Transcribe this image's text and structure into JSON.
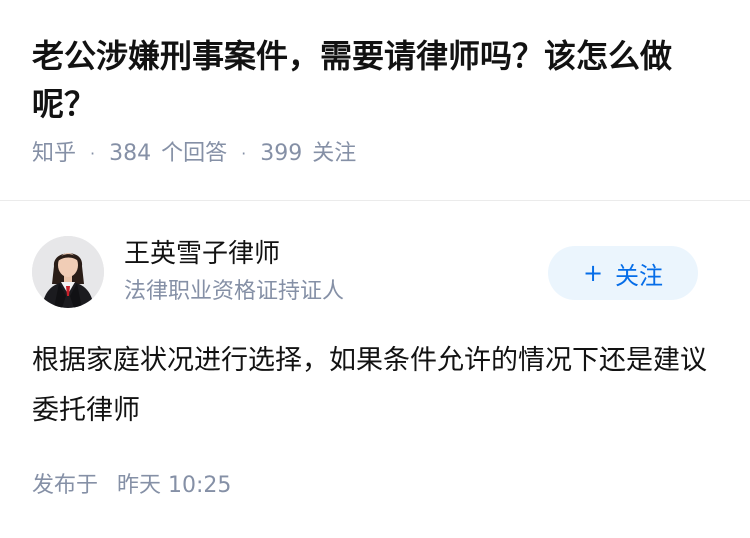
{
  "question": {
    "title": "老公涉嫌刑事案件，需要请律师吗？该怎么做呢？",
    "source": "知乎",
    "separator": "·",
    "answer_count": "384",
    "answer_label": "个回答",
    "follower_count": "399",
    "follower_label": "关注"
  },
  "author": {
    "name": "王英雪子律师",
    "title": "法律职业资格证持证人",
    "follow_plus": "+",
    "follow_label": "关注"
  },
  "answer": {
    "content": "根据家庭状况进行选择，如果条件允许的情况下还是建议委托律师"
  },
  "publish": {
    "label": "发布于",
    "time": "昨天 10:25"
  },
  "colors": {
    "text_primary": "#121212",
    "text_secondary": "#8590a6",
    "accent": "#056de8",
    "follow_bg": "#ebf5fd",
    "divider": "#ebebeb"
  },
  "icons": {
    "avatar": "lawyer-portrait-avatar"
  }
}
